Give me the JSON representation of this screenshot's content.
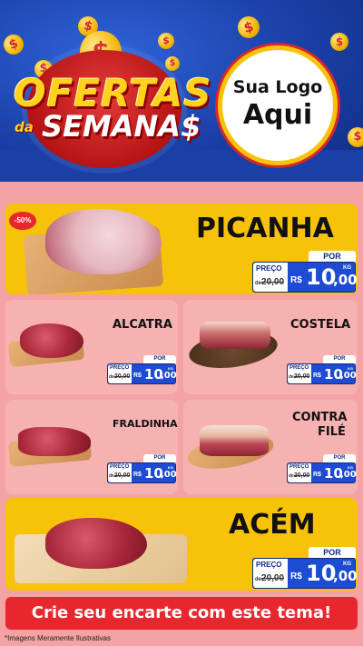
{
  "header": {
    "title_line1": "OFERTAS",
    "title_da": "da",
    "title_line2": "SEMANA$",
    "logo_line1": "Sua Logo",
    "logo_line2": "Aqui",
    "coin_symbol": "$"
  },
  "discount_badge": "-50%",
  "products": [
    {
      "name": "PICANHA",
      "por_label": "POR",
      "preco_label": "PREÇO",
      "old_prefix": "de",
      "old_price": "20,00",
      "currency": "R$",
      "price_int": "10",
      "price_dec": ",00",
      "unit": "KG"
    },
    {
      "name": "ALCATRA",
      "por_label": "POR",
      "preco_label": "PREÇO",
      "old_prefix": "de",
      "old_price": "20,00",
      "currency": "R$",
      "price_int": "10",
      "price_dec": ",00",
      "unit": "KG"
    },
    {
      "name": "COSTELA",
      "por_label": "POR",
      "preco_label": "PREÇO",
      "old_prefix": "de",
      "old_price": "20,00",
      "currency": "R$",
      "price_int": "10",
      "price_dec": ",00",
      "unit": "KG"
    },
    {
      "name": "FRALDINHA",
      "por_label": "POR",
      "preco_label": "PREÇO",
      "old_prefix": "de",
      "old_price": "20,00",
      "currency": "R$",
      "price_int": "10",
      "price_dec": ",00",
      "unit": "KG"
    },
    {
      "name_line1": "CONTRA",
      "name_line2": "FILÉ",
      "por_label": "POR",
      "preco_label": "PREÇO",
      "old_prefix": "de",
      "old_price": "20,00",
      "currency": "R$",
      "price_int": "10",
      "price_dec": ",00",
      "unit": "KG"
    },
    {
      "name": "ACÉM",
      "por_label": "POR",
      "preco_label": "PREÇO",
      "old_prefix": "de",
      "old_price": "20,00",
      "currency": "R$",
      "price_int": "10",
      "price_dec": ",00",
      "unit": "KG"
    }
  ],
  "cta": "Crie seu encarte com este tema!",
  "disclaimer": "*Imagens Meramente Ilustrativas",
  "colors": {
    "header_blue": "#1a3fa6",
    "accent_yellow": "#f6c20a",
    "card_pink": "#f6b1b1",
    "price_blue": "#1d4bd1",
    "cta_red": "#e8262d"
  }
}
